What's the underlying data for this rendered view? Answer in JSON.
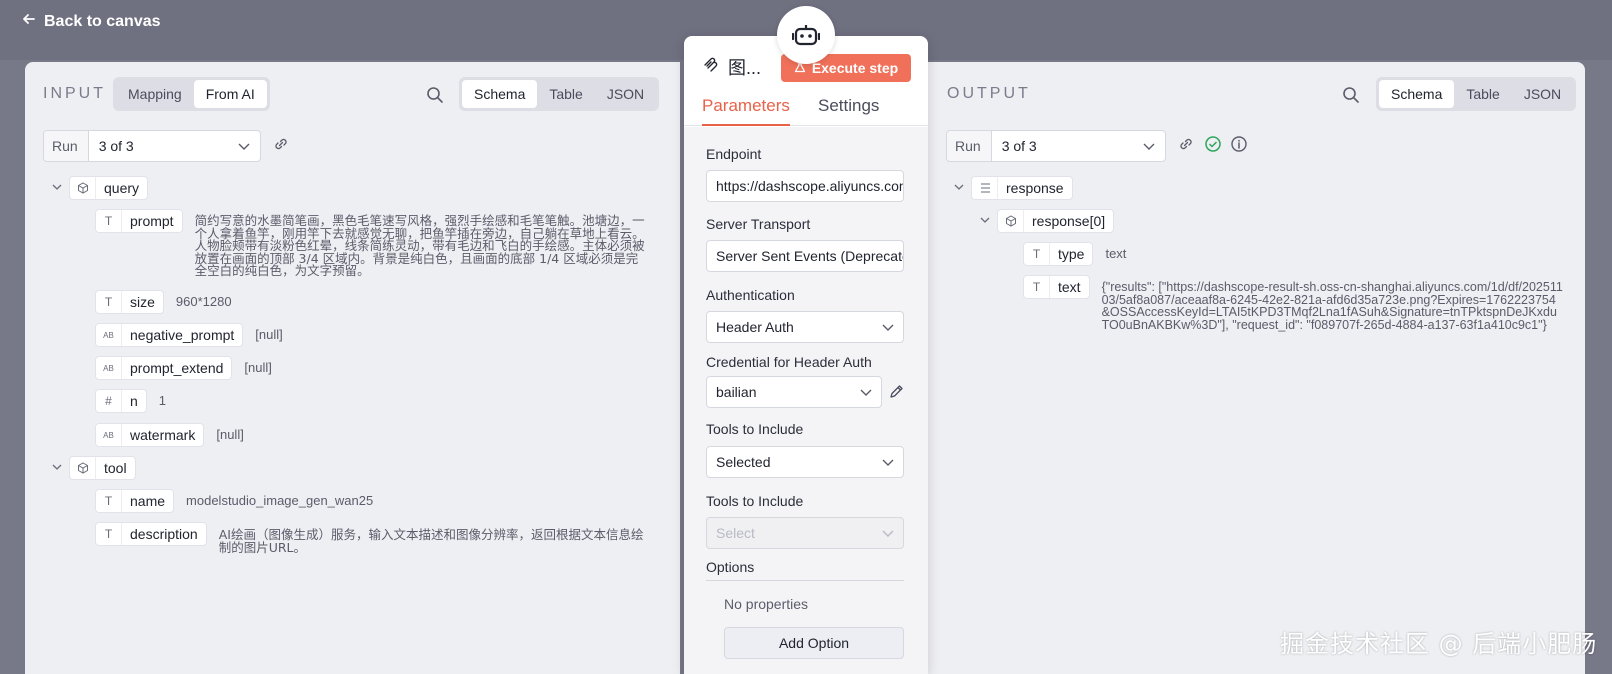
{
  "topbar": {
    "back_label": "Back to canvas"
  },
  "input_panel": {
    "title": "INPUT",
    "mode_tabs": [
      "Mapping",
      "From AI"
    ],
    "view_tabs": [
      "Schema",
      "Table",
      "JSON"
    ],
    "run_label": "Run",
    "run_value": "3 of 3",
    "tree": {
      "query": {
        "label": "query",
        "prompt": {
          "label": "prompt",
          "value": "简约写意的水墨简笔画，黑色毛笔速写风格，强烈手绘感和毛笔笔触。池塘边，一个人拿着鱼竿，刚用竿下去就感觉无聊，把鱼竿插在旁边，自己躺在草地上看云。人物脸颊带有淡粉色红晕，线条简练灵动，带有毛边和飞白的手绘感。主体必须被放置在画面的顶部 3/4 区域内。背景是纯白色，且画面的底部 1/4 区域必须是完全空白的纯白色，为文字预留。"
        },
        "size": {
          "label": "size",
          "value": "960*1280"
        },
        "negative_prompt": {
          "label": "negative_prompt",
          "value": "[null]"
        },
        "prompt_extend": {
          "label": "prompt_extend",
          "value": "[null]"
        },
        "n": {
          "label": "n",
          "value": "1"
        },
        "watermark": {
          "label": "watermark",
          "value": "[null]"
        }
      },
      "tool": {
        "label": "tool",
        "name": {
          "label": "name",
          "value": "modelstudio_image_gen_wan25"
        },
        "description": {
          "label": "description",
          "value": "AI绘画（图像生成）服务，输入文本描述和图像分辨率，返回根据文本信息绘制的图片URL。"
        }
      }
    }
  },
  "node_panel": {
    "title": "图...",
    "execute_label": "Execute step",
    "tabs": [
      "Parameters",
      "Settings"
    ],
    "endpoint": {
      "label": "Endpoint",
      "value": "https://dashscope.aliyuncs.com"
    },
    "server_transport": {
      "label": "Server Transport",
      "value": "Server Sent Events (Deprecated)"
    },
    "authentication": {
      "label": "Authentication",
      "value": "Header Auth"
    },
    "credential": {
      "label": "Credential for Header Auth",
      "value": "bailian"
    },
    "tools_include_1": {
      "label": "Tools to Include",
      "value": "Selected"
    },
    "tools_include_2": {
      "label": "Tools to Include",
      "placeholder": "Select"
    },
    "options": {
      "label": "Options",
      "empty": "No properties",
      "add_label": "Add Option"
    }
  },
  "output_panel": {
    "title": "OUTPUT",
    "view_tabs": [
      "Schema",
      "Table",
      "JSON"
    ],
    "run_label": "Run",
    "run_value": "3 of 3",
    "tree": {
      "response": {
        "label": "response"
      },
      "response0": {
        "label": "response[0]"
      },
      "type": {
        "label": "type",
        "value": "text"
      },
      "text": {
        "label": "text",
        "value": "{\"results\": [\"https://dashscope-result-sh.oss-cn-shanghai.aliyuncs.com/1d/df/20251103/5af8a087/aceaaf8a-6245-42e2-821a-afd6d35a723e.png?Expires=1762223754&OSSAccessKeyId=LTAI5tKPD3TMqf2Lna1fASuh&Signature=tnTPktspnDeJKxduTO0uBnAKBKw%3D\"], \"request_id\": \"f089707f-265d-4884-a137-63f1a410c9c1\"}"
      }
    }
  },
  "watermark": "掘金技术社区 @ 后端小肥肠",
  "colors": {
    "accent": "#e8624a",
    "execute_bg": "#f0705a",
    "success": "#2ea55b"
  }
}
